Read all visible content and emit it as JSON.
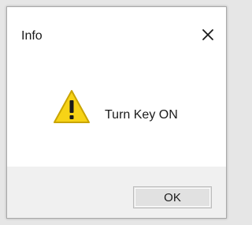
{
  "window": {
    "title": "Info",
    "close_icon": "close-icon"
  },
  "content": {
    "icon": "warning-icon",
    "message": "Turn Key ON"
  },
  "footer": {
    "ok_label": "OK"
  },
  "colors": {
    "window_background": "#f0f0f0",
    "content_background": "#ffffff",
    "warning_fill": "#f7d316",
    "warning_outline": "#c9a400",
    "button_background": "#e1e1e1",
    "button_border": "#bcbcbc"
  }
}
